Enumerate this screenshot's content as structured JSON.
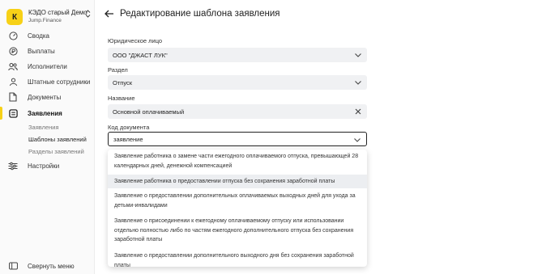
{
  "org": {
    "avatar": "К",
    "name": "КЭДО старый Демо",
    "subtitle": "Jump.Finance"
  },
  "nav": [
    {
      "label": "Сводка",
      "icon": "dashboard-icon"
    },
    {
      "label": "Выплаты",
      "icon": "payments-icon"
    },
    {
      "label": "Исполнители",
      "icon": "contractors-icon"
    },
    {
      "label": "Штатные сотрудники",
      "icon": "employee-icon"
    },
    {
      "label": "Документы",
      "icon": "document-icon"
    },
    {
      "label": "Заявления",
      "icon": "applications-icon"
    },
    {
      "label": "Настройки",
      "icon": "settings-icon"
    }
  ],
  "subnav": [
    "Заявления",
    "Шаблоны заявлений",
    "Разделы заявлений"
  ],
  "collapse_label": "Свернуть меню",
  "page_title": "Редактирование шаблона заявления",
  "form": {
    "legal_entity": {
      "label": "Юридическое лицо",
      "value": "ООО \"ДЖАСТ ЛУК\""
    },
    "section": {
      "label": "Раздел",
      "value": "Отпуск"
    },
    "name": {
      "label": "Название",
      "value": "Основной оплачиваемый"
    },
    "doc_code": {
      "label": "Код документа",
      "value": "заявление"
    }
  },
  "options": [
    "Заявление работника о замене части ежегодного оплачиваемого отпуска, превышающей 28 календарных дней, денежной компенсацией",
    "Заявление работника о предоставлении отпуска без сохранения заработной платы",
    "Заявление о предоставлении дополнительных оплачиваемых выходных дней для ухода за детьми-инвалидами",
    "Заявление о присоединении к ежегодному оплачиваемому отпуску или использовании отдельно полностью либо по частям ежегодного дополнительного отпуска без сохранения заработной платы",
    "Заявление о предоставлении дополнительного выходного дня без сохранения заработной платы"
  ],
  "colors": {
    "accent": "#f7d117",
    "field_bg": "#f0f1f3",
    "hover": "#eceef1"
  }
}
